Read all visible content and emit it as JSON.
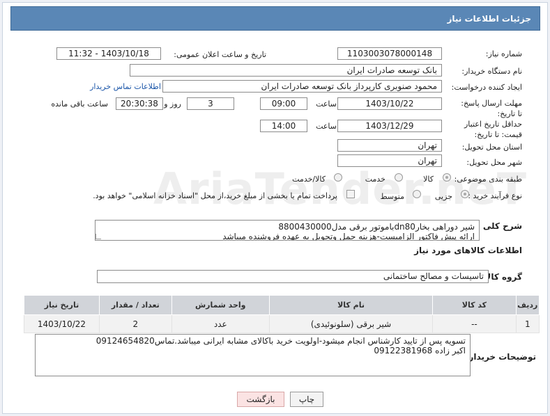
{
  "header": {
    "title": "جزئیات اطلاعات نیاز"
  },
  "form": {
    "need_number_label": "شماره نیاز:",
    "need_number": "1103003078000148",
    "announce_label": "تاریخ و ساعت اعلان عمومی:",
    "announce_value": "1403/10/18 - 11:32",
    "buyer_org_label": "نام دستگاه خریدار:",
    "buyer_org": "بانک توسعه صادرات ایران",
    "requester_label": "ایجاد کننده درخواست:",
    "requester": "محمود صنوبری کارپرداز بانک توسعه صادرات ایران",
    "contact_link": "اطلاعات تماس خریدار",
    "reply_deadline_label": "مهلت ارسال پاسخ: تا تاریخ:",
    "reply_date": "1403/10/22",
    "time_label": "ساعت",
    "reply_time": "09:00",
    "days_value": "3",
    "days_label": "روز و",
    "remaining_time": "20:30:38",
    "remaining_label": "ساعت باقی مانده",
    "validity_label": "حداقل تاریخ اعتبار قیمت: تا تاریخ:",
    "validity_date": "1403/12/29",
    "validity_time_label": "ساعت",
    "validity_time": "14:00",
    "province_label": "استان محل تحویل:",
    "province": "تهران",
    "city_label": "شهر محل تحویل:",
    "city": "تهران",
    "category_label": "طبقه بندی موضوعی:",
    "category_options": [
      "کالا",
      "خدمت",
      "کالا/خدمت"
    ],
    "process_label": "نوع فرآیند خرید :",
    "process_options": [
      "جزیی",
      "متوسط"
    ],
    "payment_note": "پرداخت تمام یا بخشی از مبلغ خرید،از محل \"اسناد خزانه اسلامی\" خواهد بود.",
    "description_label": "شرح کلی نیاز:",
    "description_line1": "شیر دوراهی بخارdn80باموتور برقی مدل8800430000",
    "description_line2": "ارائه پیش فاکتور الزامیست-هزینه حمل وتحویل به عهده فروشنده میباشد"
  },
  "goods": {
    "section_title": "اطلاعات کالاهای مورد نیاز",
    "group_label": "گروه کالا:",
    "group_value": "تاسیسات و مصالح ساختمانی",
    "columns": [
      "ردیف",
      "کد کالا",
      "نام کالا",
      "واحد شمارش",
      "تعداد / مقدار",
      "تاریخ نیاز"
    ],
    "rows": [
      [
        "1",
        "--",
        "شیر برقی (سلونوئیدی)",
        "عدد",
        "2",
        "1403/10/22"
      ]
    ]
  },
  "buyer_notes": {
    "label": "توضیحات خریدار:",
    "line1": "تسویه پس از تایید کارشناس انجام میشود-اولویت خرید باکالای مشابه ایرانی میباشد.تماس09124654820",
    "line2": "اکبر زاده    09122381968"
  },
  "buttons": {
    "print": "چاپ",
    "back": "بازگشت"
  },
  "watermark": "AriaTender.neT"
}
